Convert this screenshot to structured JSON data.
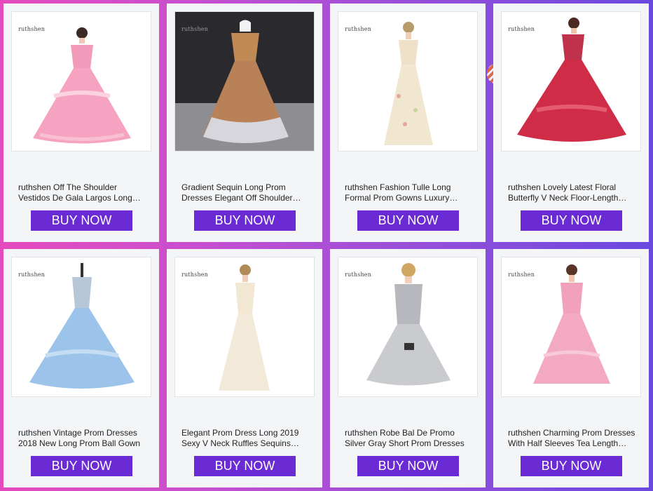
{
  "cta_label": "BUY NOW",
  "colors": {
    "cta": "#6a2ad4",
    "card_bg": "#f4f5f7"
  },
  "products": [
    {
      "brand": "ruthshen",
      "title": "ruthshen Off The Shoulder Vestidos De Gala Largos Long Prom Dresses",
      "image": "pink-ballgown-dress"
    },
    {
      "brand": "ruthshen",
      "title": "Gradient Sequin Long Prom Dresses Elegant Off Shoulder Evening Gown",
      "image": "gold-silver-sequin-gown"
    },
    {
      "brand": "ruthshen",
      "title": "ruthshen Fashion Tulle Long Formal Prom Gowns Luxury Embroidery",
      "image": "champagne-floral-tulle-gown"
    },
    {
      "brand": "ruthshen",
      "title": "ruthshen Lovely Latest Floral Butterfly V Neck Floor-Length Quinceanera Dresses",
      "image": "red-floral-ballgown"
    },
    {
      "brand": "ruthshen",
      "title": "ruthshen Vintage Prom Dresses 2018 New Long Prom Ball Gown",
      "image": "light-blue-ballgown"
    },
    {
      "brand": "ruthshen",
      "title": "Elegant Prom Dress Long 2019 Sexy V Neck Ruffles Sequins Evening Gown",
      "image": "ivory-v-neck-gown"
    },
    {
      "brand": "ruthshen",
      "title": "ruthshen Robe Bal De Promo Silver Gray Short Prom Dresses",
      "image": "silver-short-dress"
    },
    {
      "brand": "ruthshen",
      "title": "ruthshen Charming Prom Dresses With Half Sleeves Tea Length Lace",
      "image": "pink-lace-tea-length-dress"
    }
  ]
}
